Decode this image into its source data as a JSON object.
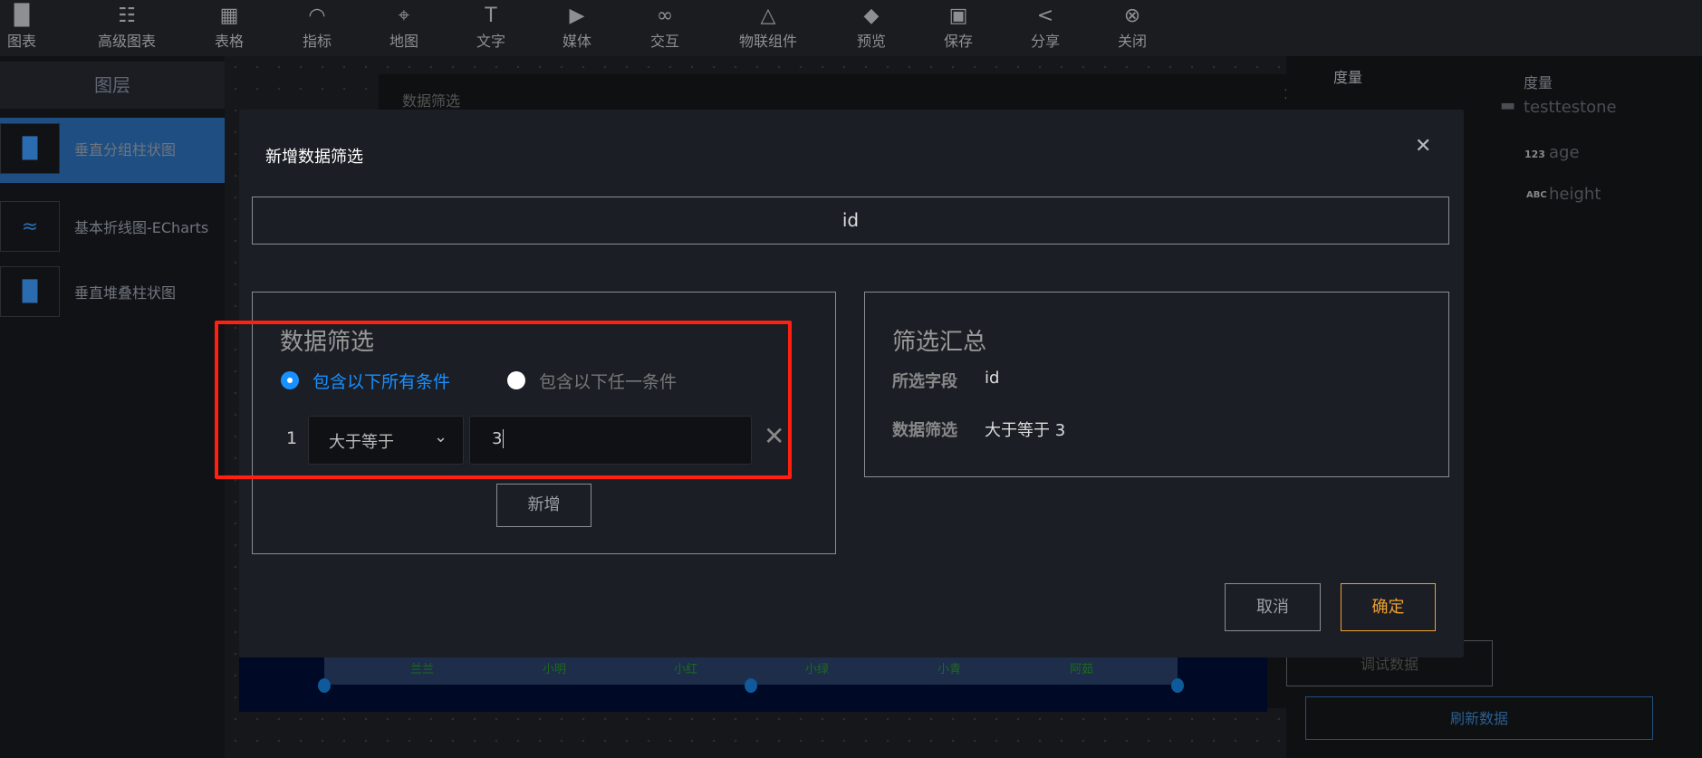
{
  "toolbar": [
    {
      "label": "图表",
      "icon": "bar-chart-icon"
    },
    {
      "label": "高级图表",
      "icon": "layout-icon"
    },
    {
      "label": "表格",
      "icon": "table-icon"
    },
    {
      "label": "指标",
      "icon": "gauge-icon"
    },
    {
      "label": "地图",
      "icon": "map-pin-icon"
    },
    {
      "label": "文字",
      "icon": "text-icon"
    },
    {
      "label": "媒体",
      "icon": "play-icon"
    },
    {
      "label": "交互",
      "icon": "link-icon"
    },
    {
      "label": "物联组件",
      "icon": "iot-icon"
    },
    {
      "label": "预览",
      "icon": "cube-icon"
    },
    {
      "label": "保存",
      "icon": "save-icon"
    },
    {
      "label": "分享",
      "icon": "share-icon"
    },
    {
      "label": "关闭",
      "icon": "close-circle-icon"
    }
  ],
  "layers": {
    "title": "图层",
    "items": [
      {
        "label": "垂直分组柱状图",
        "icon": "bar-chart-icon",
        "selected": true
      },
      {
        "label": "基本折线图-ECharts",
        "icon": "line-chart-icon"
      },
      {
        "label": "垂直堆叠柱状图",
        "icon": "bar-chart-icon"
      }
    ]
  },
  "background": {
    "panel_title": "数据筛选",
    "x_labels": [
      "兰兰",
      "小明",
      "小红",
      "小绿",
      "小青",
      "阿茹"
    ]
  },
  "right_panel": {
    "measure_label": "度量",
    "measure_title": "度量",
    "dataset": "testtestone",
    "fields": [
      {
        "type": "123",
        "name": "age"
      },
      {
        "type": "ABC",
        "name": "height"
      }
    ],
    "debug_button": "调试数据",
    "refresh_button": "刷新数据"
  },
  "dialog": {
    "title": "新增数据筛选",
    "field": "id",
    "filter": {
      "heading": "数据筛选",
      "radio_all": "包含以下所有条件",
      "radio_any": "包含以下任一条件",
      "selected": "all",
      "rows": [
        {
          "index": "1",
          "operator": "大于等于",
          "value": "3"
        }
      ],
      "add_button": "新增"
    },
    "summary": {
      "heading": "筛选汇总",
      "field_label": "所选字段",
      "field_value": "id",
      "filter_label": "数据筛选",
      "filter_value": "大于等于 3"
    },
    "cancel": "取消",
    "ok": "确定"
  },
  "colors": {
    "accent": "#1890ff",
    "ok": "#f0a030",
    "highlight": "#ff2010",
    "selected_layer": "#1f4f82"
  }
}
